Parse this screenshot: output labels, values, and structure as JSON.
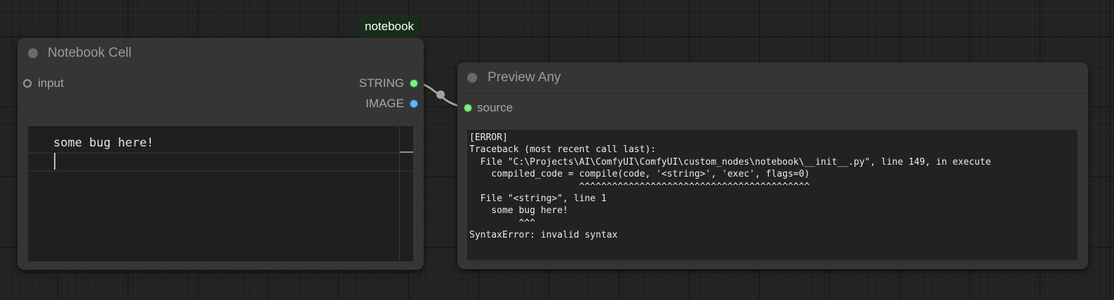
{
  "badge": "notebook",
  "notebook_node": {
    "title": "Notebook Cell",
    "input_label": "input",
    "outputs": [
      "STRING",
      "IMAGE"
    ],
    "code": "some bug here!"
  },
  "preview_node": {
    "title": "Preview Any",
    "input_label": "source",
    "output": "[ERROR]\nTraceback (most recent call last):\n  File \"C:\\Projects\\AI\\ComfyUI\\ComfyUI\\custom_nodes\\notebook\\__init__.py\", line 149, in execute\n    compiled_code = compile(code, '<string>', 'exec', flags=0)\n                    ^^^^^^^^^^^^^^^^^^^^^^^^^^^^^^^^^^^^^^^^^^\n  File \"<string>\", line 1\n    some bug here!\n         ^^^\nSyntaxError: invalid syntax"
  },
  "colors": {
    "string_slot": "#7cf07c",
    "image_slot": "#64b5f6",
    "badge_bg": "#192e1a",
    "link": "#9aa89a"
  }
}
